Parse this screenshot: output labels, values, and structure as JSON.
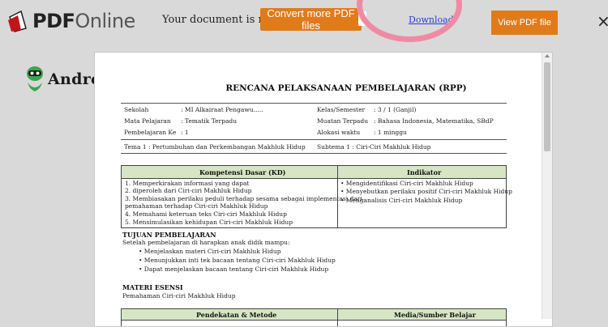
{
  "header": {
    "logo_bold": "PDF",
    "logo_light": "Online",
    "status_text": "Your document is ready",
    "convert_label": "Convert more PDF files",
    "download_label": "Download",
    "view_label": "View PDF file",
    "close_label": "×"
  },
  "watermark": {
    "text": "AndroidHijau"
  },
  "document": {
    "title": "RENCANA PELAKSANAAN PEMBELAJARAN (RPP)",
    "info": [
      {
        "label": "Sekolah",
        "value": ": MI Alkairaat Pengawu....."
      },
      {
        "label": "Mata Pelajaran",
        "value": ": Tematik Terpadu"
      },
      {
        "label": "Pembelajaran Ke",
        "value": ": 1"
      },
      {
        "label": "Kelas/Semester",
        "value": ": 3 / 1 (Ganjil)"
      },
      {
        "label": "Muatan Terpadu",
        "value": ": Bahasa Indonesia, Matematika, SBdP"
      },
      {
        "label": "Alokasi waktu",
        "value": ": 1 minggu"
      }
    ],
    "tema": "Tema 1 : Pertumbuhan dan Perkembangan Makhluk Hidup",
    "subtema": "Subtema 1 : Ciri-Ciri Makhluk Hidup",
    "kd_header": "Kompetensi Dasar (KD)",
    "indikator_header": "Indikator",
    "kd_items": [
      "1.    Memperkirakan informasi yang dapat",
      "2.    diperoleh dari Ciri-ciri Makhluk Hidup",
      "3.    Membiasakan perilaku peduli terhadap sesama sebagai implementasi dari",
      "        pemahaman terhadap Ciri-ciri Makhluk Hidup",
      "4.    Memahami keteruan teks Ciri-ciri Makhluk Hidup",
      "5.    Mensimulasikan kehidupan Ciri-ciri Makhluk Hidup"
    ],
    "indikator_items": [
      "• Mengidentifikasi Ciri-ciri Makhluk Hidup",
      "• Menyebutkan perilaku positif Ciri-ciri Makhluk Hidup",
      "• Menganalisis Ciri-ciri Makhluk Hidup"
    ],
    "tujuan_title": "TUJUAN PEMBELAJARAN",
    "tujuan_intro": "Setelah pembelajaran di harapkan anak didik mampu:",
    "tujuan_items": [
      "• Menjelaskan materi Ciri-ciri Makhluk Hidup",
      "• Menunjukkan inti tek bacaan tentang Ciri-ciri Makhluk Hidup",
      "• Dapat menjelaskan bacaan tentang Ciri-ciri Makhluk Hidup"
    ],
    "materi_title": "MATERI ESENSI",
    "materi_text": "Pemahaman Ciri-ciri Makhluk Hidup",
    "pendekatan_header": "Pendekatan & Metode",
    "media_header": "Media/Sumber Belajar"
  },
  "colors": {
    "accent": "#e07b1c",
    "table_header": "#d6e6c4",
    "annotation": "#f08aa4"
  }
}
